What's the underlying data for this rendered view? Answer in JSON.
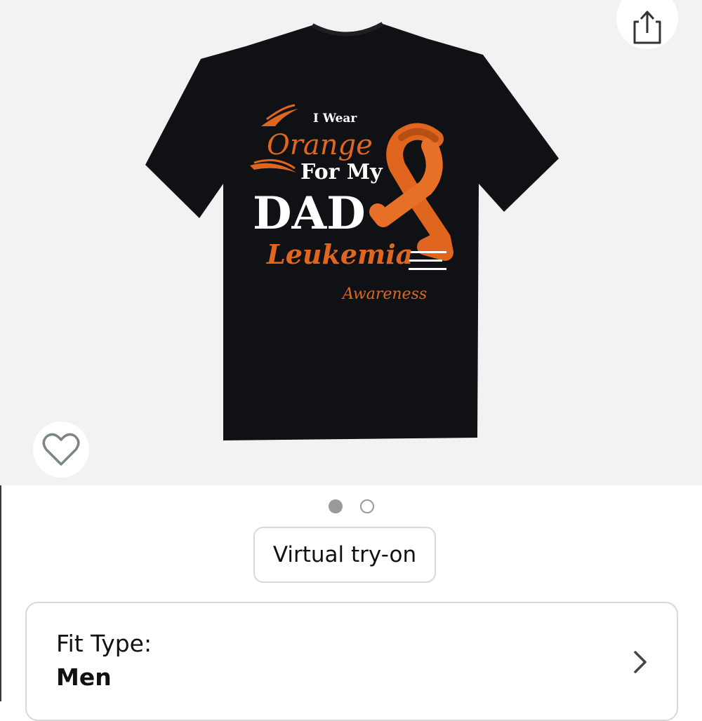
{
  "icons": {
    "share": "share-icon",
    "favorite": "heart-outline-icon",
    "chevron": "chevron-right-icon"
  },
  "product_image": {
    "shirt_text": {
      "line1": "I Wear",
      "line2": "Orange",
      "line3": "For My",
      "line4": "DAD",
      "line5": "Leukemia",
      "line6": "Awareness"
    },
    "colors": {
      "shirt": "#101114",
      "accent_orange": "#e0661f",
      "text_white": "#ffffff"
    }
  },
  "carousel": {
    "total": 2,
    "active_index": 0
  },
  "virtual_tryon": {
    "label": "Virtual try-on"
  },
  "fit_type": {
    "label": "Fit Type:",
    "value": "Men"
  }
}
